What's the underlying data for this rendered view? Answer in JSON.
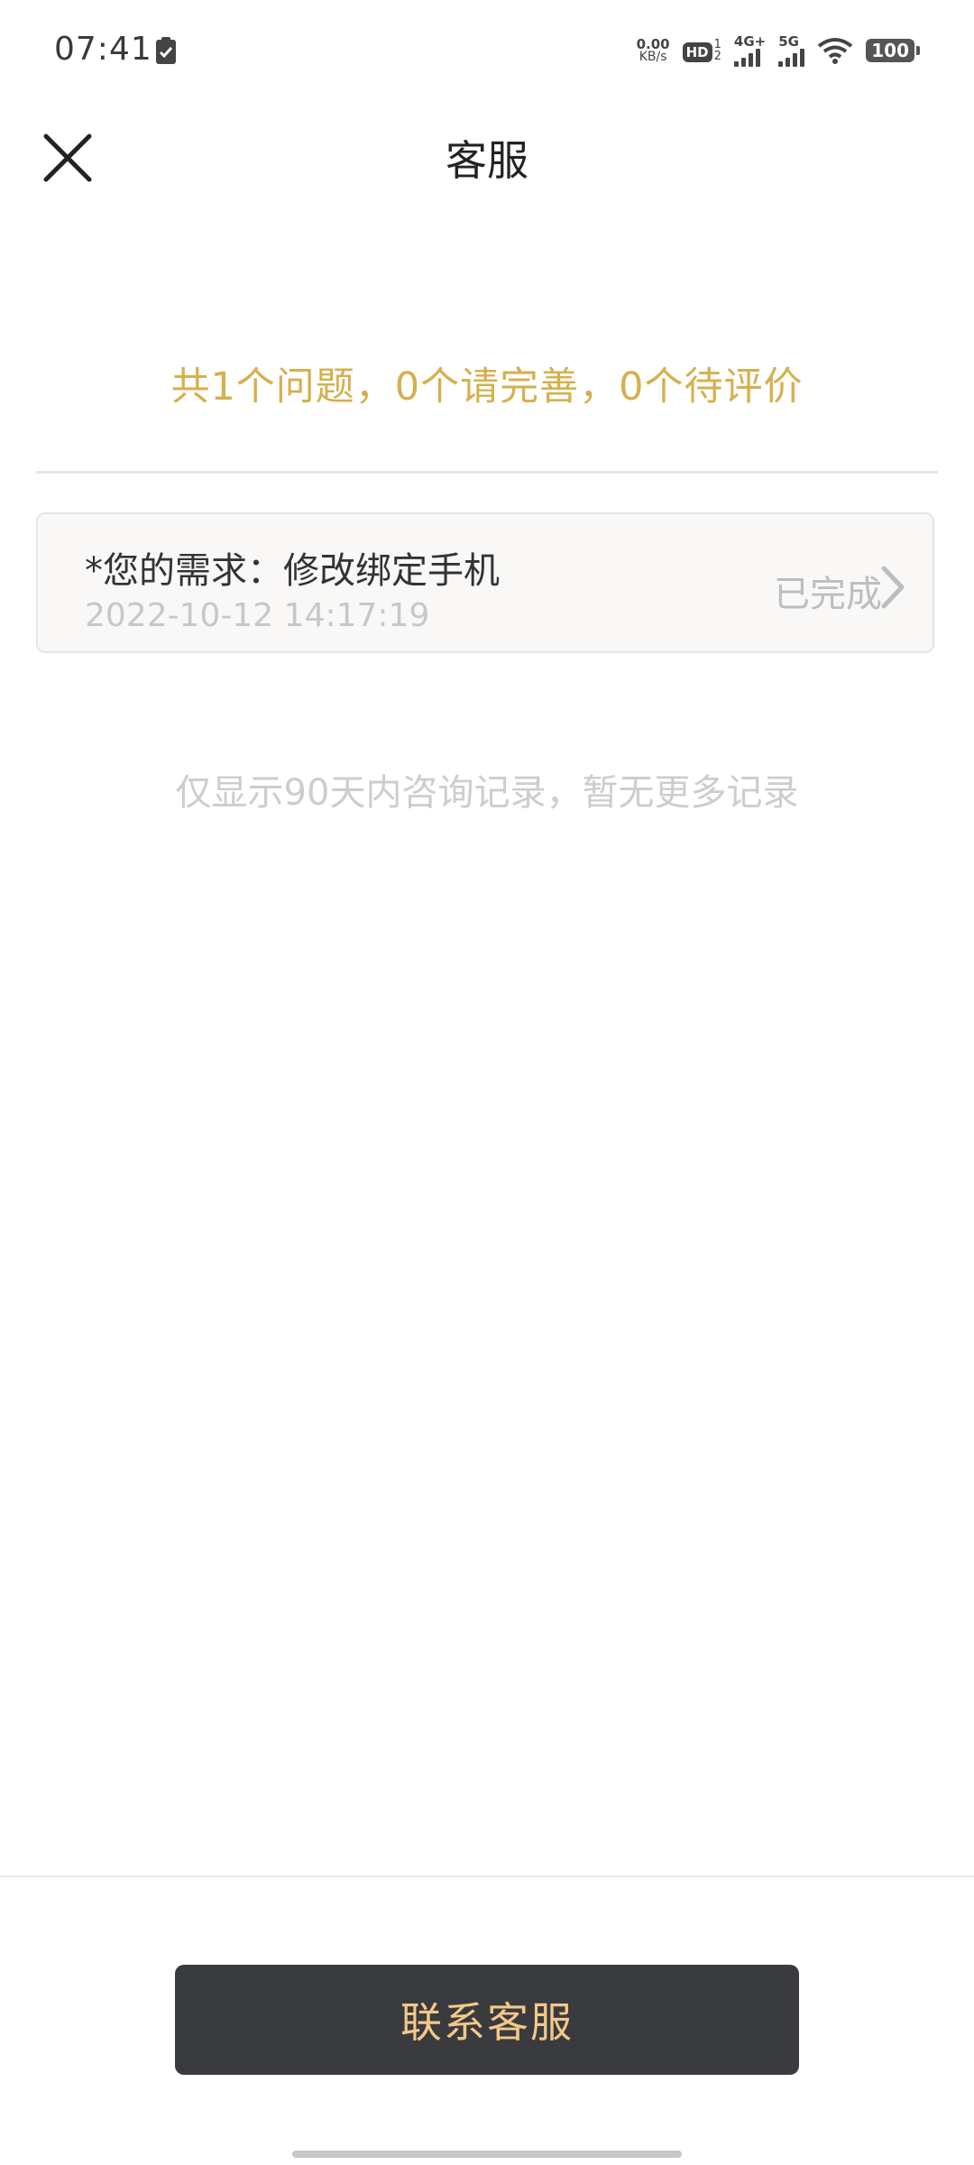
{
  "status_bar": {
    "time": "07:41",
    "net_speed_value": "0.00",
    "net_speed_unit": "KB/s",
    "hd_label": "HD",
    "hd_sub_top": "1",
    "hd_sub_bottom": "2",
    "signal1_label": "4G+",
    "signal2_label": "5G",
    "battery": "100"
  },
  "header": {
    "title": "客服"
  },
  "summary": {
    "text": "共1个问题，0个请完善，0个待评价"
  },
  "records": [
    {
      "title": "*您的需求：修改绑定手机",
      "time": "2022-10-12 14:17:19",
      "status": "已完成"
    }
  ],
  "note": "仅显示90天内咨询记录，暂无更多记录",
  "footer": {
    "contact_button": "联系客服"
  },
  "colors": {
    "accent_gold": "#d5b04e",
    "button_bg": "#3a3b3e",
    "button_text": "#f3c889"
  }
}
